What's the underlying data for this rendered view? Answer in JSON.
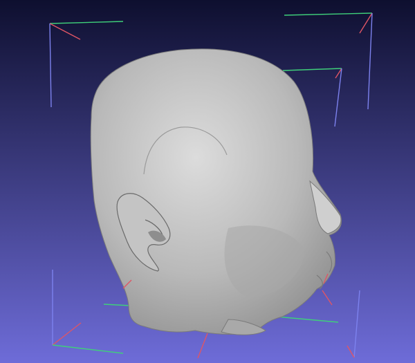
{
  "viewport": {
    "background_top": "#0e0f2f",
    "background_bottom": "#6e6cd8",
    "mesh_color": "#b9b9b9",
    "mesh_shadow": "#6f6f6f",
    "mesh_highlight": "#dcdcdc"
  },
  "bbox_axes": {
    "x_axis_color": "#e05565",
    "y_axis_color": "#3fd07a",
    "z_axis_color": "#7d82ee"
  },
  "icons": {
    "mesh": "head-mesh-icon"
  }
}
